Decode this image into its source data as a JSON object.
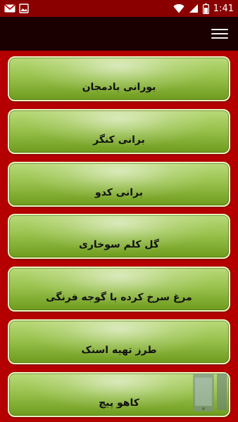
{
  "status_bar": {
    "time": "1:41",
    "icons": [
      "gmail-icon",
      "photo-icon",
      "wifi-icon",
      "signal-icon",
      "battery-icon"
    ]
  },
  "app_bar": {
    "menu_icon": "hamburger-icon"
  },
  "items": [
    {
      "label": "بورانی بادمجان"
    },
    {
      "label": "برانی کنگر"
    },
    {
      "label": "برانی کدو"
    },
    {
      "label": "گل کلم سوخاری"
    },
    {
      "label": "مرغ سرخ کرده با گوجه فرنگی"
    },
    {
      "label": "طرز تهیه اسنک"
    },
    {
      "label": "کاهو پیچ"
    }
  ],
  "colors": {
    "status_bar": "#8a0000",
    "app_bar": "#1a0000",
    "background": "#b40000",
    "button_green": "#99c24e"
  }
}
